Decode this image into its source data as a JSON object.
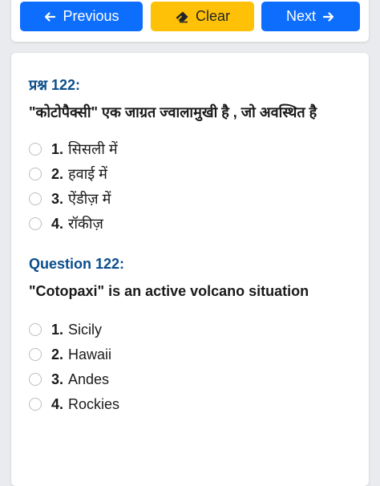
{
  "nav": {
    "previous_label": "Previous",
    "clear_label": "Clear",
    "next_label": "Next"
  },
  "hindi": {
    "label": "प्रश्न 122:",
    "question": "\"कोटोपैक्सी\" एक जाग्रत ज्वालामुखी है , जो अवस्थित है",
    "options": [
      {
        "num": "1.",
        "text": "सिसली में"
      },
      {
        "num": "2.",
        "text": "हवाई में"
      },
      {
        "num": "3.",
        "text": "ऐंडीज़ में"
      },
      {
        "num": "4.",
        "text": "रॉकीज़"
      }
    ]
  },
  "english": {
    "label": "Question 122:",
    "question": "\"Cotopaxi\" is an active volcano situation",
    "options": [
      {
        "num": "1.",
        "text": "Sicily"
      },
      {
        "num": "2.",
        "text": "Hawaii"
      },
      {
        "num": "3.",
        "text": "Andes"
      },
      {
        "num": "4.",
        "text": "Rockies"
      }
    ]
  },
  "colors": {
    "primary": "#0d6efd",
    "warning": "#ffc107",
    "label_blue": "#0a4d8c"
  },
  "icons": {
    "previous": "arrow-left-icon",
    "clear": "eraser-icon",
    "next": "arrow-right-icon"
  }
}
